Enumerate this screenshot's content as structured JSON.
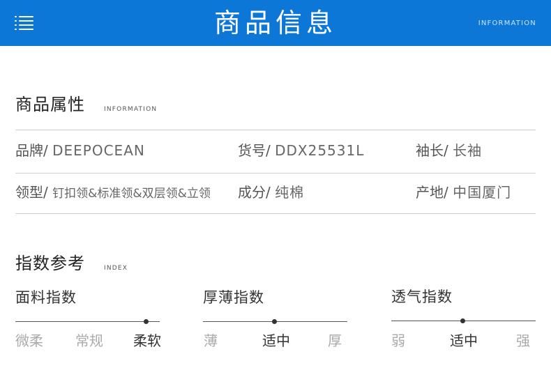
{
  "header": {
    "title": "商品信息",
    "subtitle": "INFORMATION"
  },
  "attributes": {
    "title": "商品属性",
    "subtitle": "INFORMATION",
    "rows": [
      [
        {
          "key": "品牌/",
          "value": "DEEPOCEAN"
        },
        {
          "key": "货号/",
          "value": "DDX25531L"
        },
        {
          "key": "袖长/",
          "value": "长袖"
        }
      ],
      [
        {
          "key": "领型/",
          "value": "钉扣领&标准领&双层领&立领"
        },
        {
          "key": "成分/",
          "value": "纯棉"
        },
        {
          "key": "产地/",
          "value": "中国厦门"
        }
      ]
    ]
  },
  "index": {
    "title": "指数参考",
    "subtitle": "INDEX",
    "gauges": [
      {
        "title": "面料指数",
        "labels": [
          "微柔",
          "常规",
          "柔软"
        ],
        "selected": 2
      },
      {
        "title": "厚薄指数",
        "labels": [
          "薄",
          "适中",
          "厚"
        ],
        "selected": 1
      },
      {
        "title": "透气指数",
        "labels": [
          "弱",
          "适中",
          "强"
        ],
        "selected": 1
      }
    ]
  }
}
